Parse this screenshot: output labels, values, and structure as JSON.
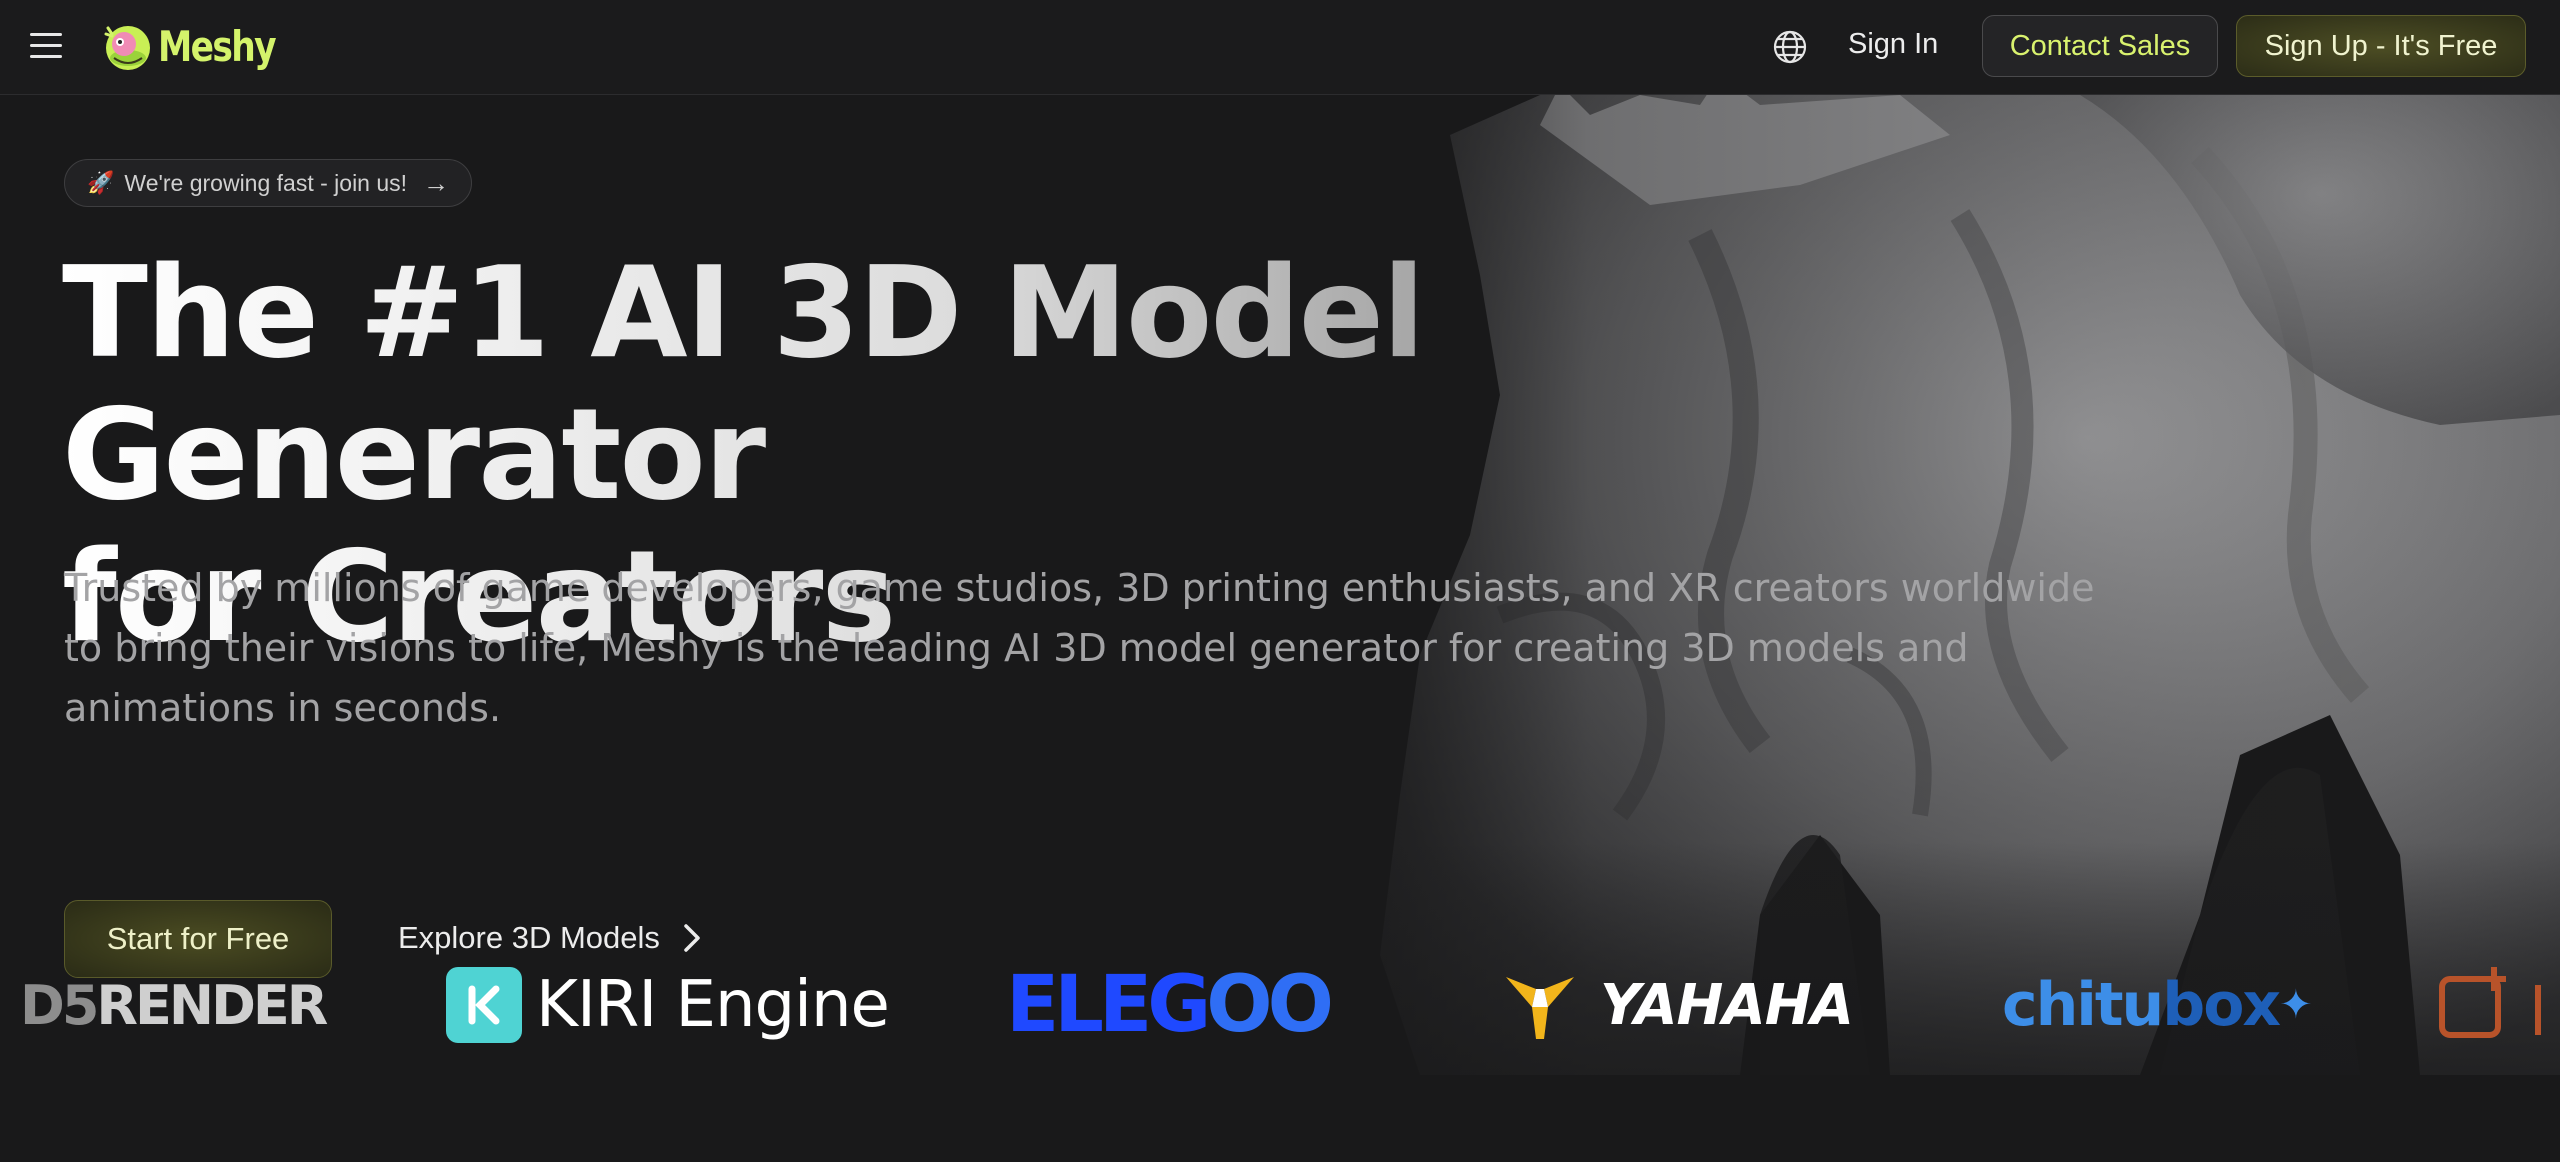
{
  "header": {
    "brand": "Meshy",
    "sign_in": "Sign In",
    "contact_sales": "Contact Sales",
    "sign_up": "Sign Up - It's Free"
  },
  "hero": {
    "badge": "We're growing fast - join us!",
    "headline_line1": "The #1 AI 3D Model Generator",
    "headline_line2": "for Creators",
    "subtitle": "Trusted by millions of game developers, game studios, 3D printing enthusiasts, and XR creators worldwide to bring their visions to life, Meshy is the leading AI 3D model generator for creating 3D models and animations in seconds.",
    "start_button": "Start for Free",
    "explore_button": "Explore 3D Models"
  },
  "partners": {
    "d5_prefix": "D5",
    "d5_suffix": " RENDER",
    "kiri": "KIRI Engine",
    "elegoo_main": "ELEG",
    "elegoo_oo": "OO",
    "yahaha": "YAHAHA",
    "chitubox_a": "chitu",
    "chitubox_b": "box"
  },
  "colors": {
    "background": "#19191a",
    "accent_lime": "#d4f36b",
    "elegoo_blue": "#1f49ff",
    "kiri_teal": "#4fd3d3"
  },
  "icons": [
    "menu-icon",
    "globe-icon",
    "rocket-icon",
    "arrow-right-icon",
    "chevron-right-icon"
  ]
}
